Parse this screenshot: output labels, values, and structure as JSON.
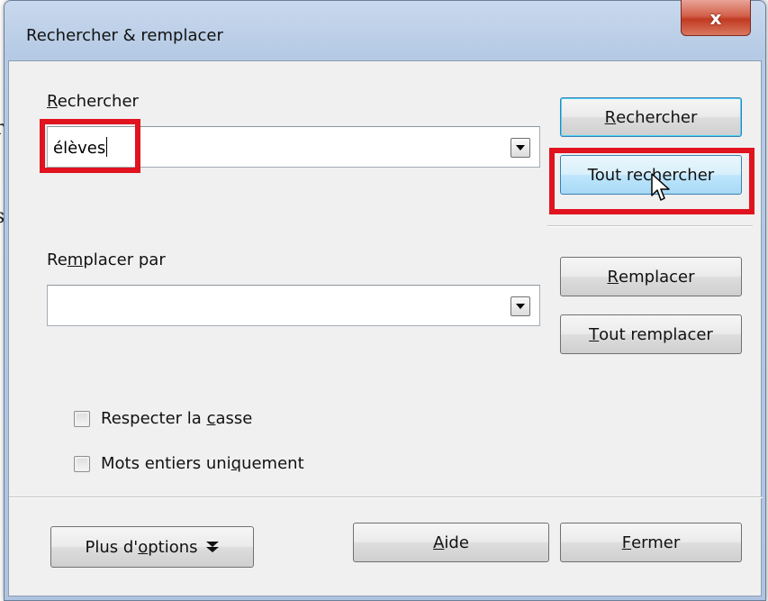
{
  "window": {
    "title": "Rechercher & remplacer",
    "close_glyph": "x"
  },
  "search": {
    "label_u": "R",
    "label_rest": "echercher",
    "value": "élèves"
  },
  "replace": {
    "label_a": "Re",
    "label_u": "m",
    "label_b": "placer par",
    "value": ""
  },
  "buttons": {
    "find_u": "R",
    "find_rest": "echercher",
    "find_all": "Tout rechercher",
    "replace_u": "R",
    "replace_rest": "emplacer",
    "replace_all_u": "T",
    "replace_all_rest": "out remplacer",
    "more_options_a": "Plus d'",
    "more_options_u": "o",
    "more_options_b": "ptions",
    "help_u": "A",
    "help_rest": "ide",
    "close_u": "F",
    "close_rest": "ermer"
  },
  "options": {
    "match_case_a": "Respecter la ",
    "match_case_u": "c",
    "match_case_b": "asse",
    "whole_words_a": "Mots entiers uni",
    "whole_words_u": "q",
    "whole_words_b": "uement"
  },
  "background": {
    "char1": "r",
    "char2": "s"
  },
  "colors": {
    "highlight": "#e0131f",
    "close_button": "#c13a22"
  },
  "icons": {
    "more_options": "double-chevron-down-icon",
    "combo": "dropdown-arrow-icon",
    "cursor": "mouse-pointer-icon"
  }
}
